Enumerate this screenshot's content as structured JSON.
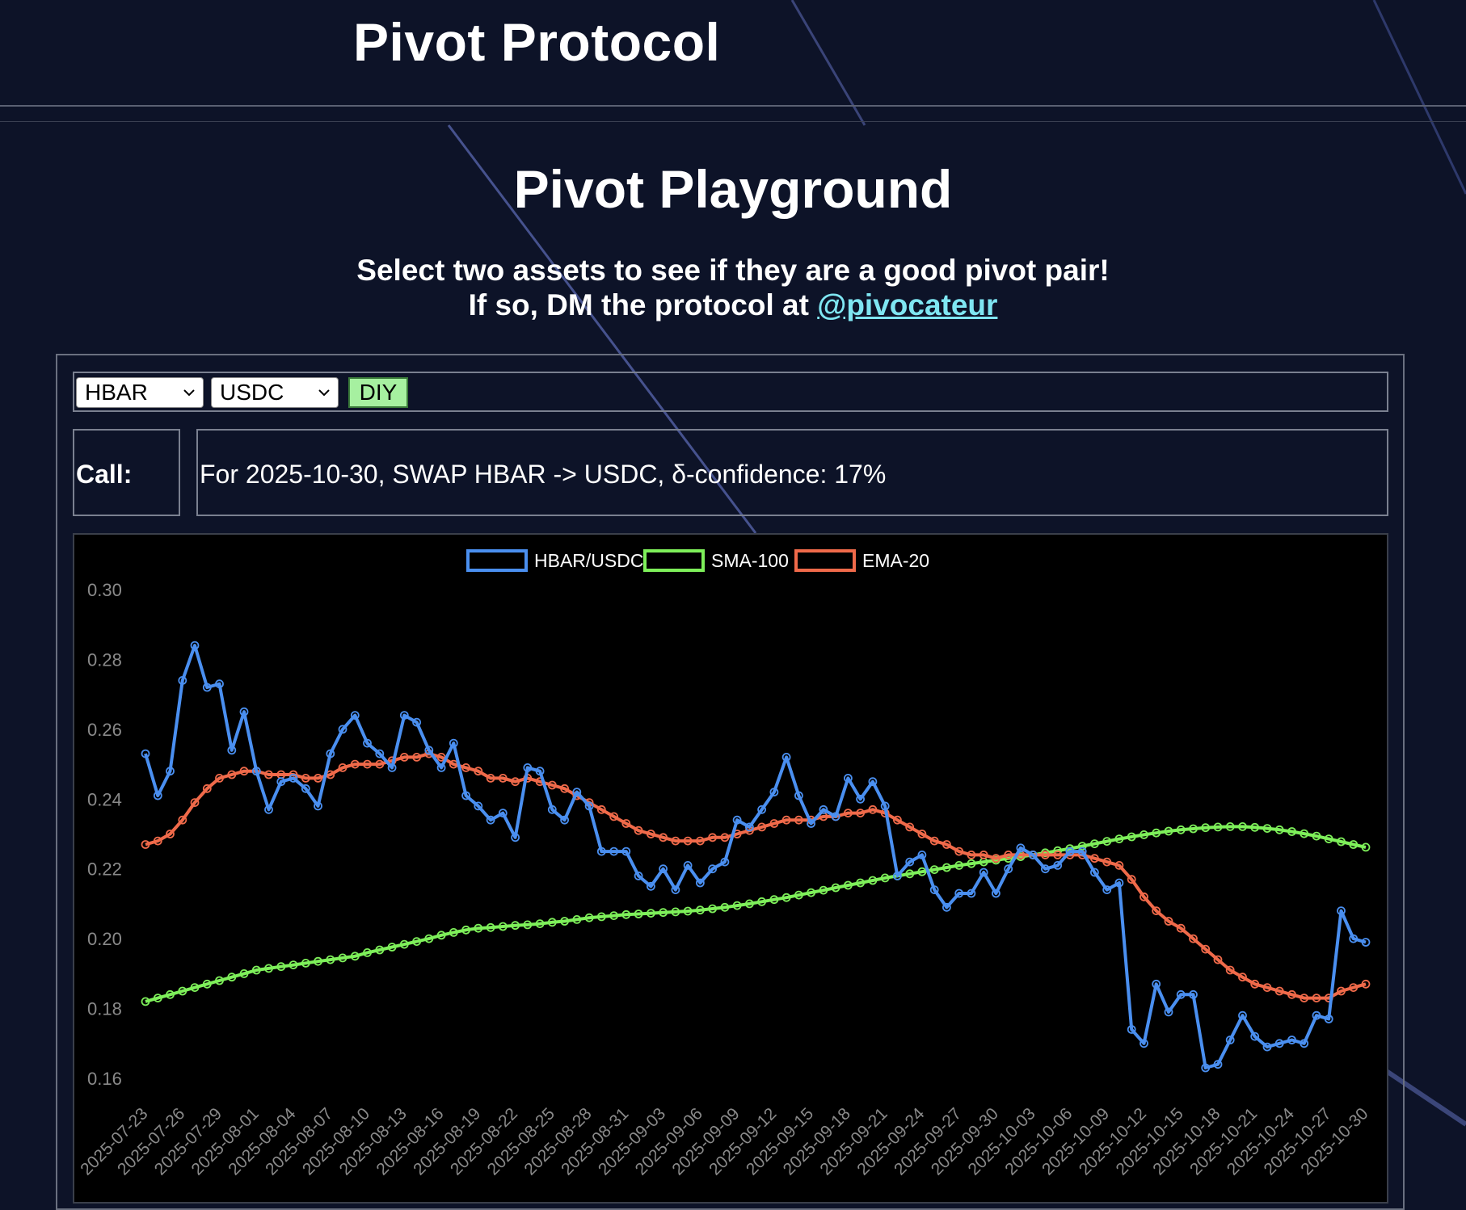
{
  "header": {
    "brand": "Pivot Protocol"
  },
  "main": {
    "title": "Pivot Playground",
    "subtitle_line1": "Select two assets to see if they are a good pivot pair!",
    "subtitle_line2_prefix": "If so, DM the protocol at ",
    "subtitle_link": "@pivocateur"
  },
  "controls": {
    "base_asset": "HBAR",
    "quote_asset": "USDC",
    "diy_label": "DIY"
  },
  "call": {
    "label": "Call:",
    "text": "For 2025-10-30, SWAP HBAR -> USDC, δ-confidence: 17%"
  },
  "colors": {
    "background": "#0d1328",
    "link": "#7fe6f2",
    "diy_button": "#a6f0a0"
  },
  "chart_data": {
    "type": "line",
    "title": "",
    "legend_position": "top",
    "grid": false,
    "ylim": [
      0.155,
      0.3
    ],
    "y_ticks": [
      "0.30",
      "0.28",
      "0.26",
      "0.24",
      "0.22",
      "0.20",
      "0.18",
      "0.16"
    ],
    "x_tick_labels": [
      "2025-07-23",
      "2025-07-26",
      "2025-07-29",
      "2025-08-01",
      "2025-08-04",
      "2025-08-07",
      "2025-08-10",
      "2025-08-13",
      "2025-08-16",
      "2025-08-19",
      "2025-08-22",
      "2025-08-25",
      "2025-08-28",
      "2025-08-31",
      "2025-09-03",
      "2025-09-06",
      "2025-09-09",
      "2025-09-12",
      "2025-09-15",
      "2025-09-18",
      "2025-09-21",
      "2025-09-24",
      "2025-09-27",
      "2025-09-30",
      "2025-10-03",
      "2025-10-06",
      "2025-10-09",
      "2025-10-12",
      "2025-10-15",
      "2025-10-18",
      "2025-10-21",
      "2025-10-24",
      "2025-10-27",
      "2025-10-30"
    ],
    "series": [
      {
        "name": "HBAR/USDC",
        "color": "#4a8ff0",
        "values": [
          0.253,
          0.241,
          0.248,
          0.274,
          0.284,
          0.272,
          0.273,
          0.254,
          0.265,
          0.248,
          0.237,
          0.245,
          0.246,
          0.243,
          0.238,
          0.253,
          0.26,
          0.264,
          0.256,
          0.253,
          0.249,
          0.264,
          0.262,
          0.254,
          0.249,
          0.256,
          0.241,
          0.238,
          0.234,
          0.236,
          0.229,
          0.249,
          0.248,
          0.237,
          0.234,
          0.242,
          0.238,
          0.225,
          0.225,
          0.225,
          0.218,
          0.215,
          0.22,
          0.214,
          0.221,
          0.216,
          0.22,
          0.222,
          0.234,
          0.232,
          0.237,
          0.242,
          0.252,
          0.241,
          0.233,
          0.237,
          0.235,
          0.246,
          0.24,
          0.245,
          0.238,
          0.218,
          0.222,
          0.224,
          0.214,
          0.209,
          0.213,
          0.213,
          0.219,
          0.213,
          0.22,
          0.226,
          0.224,
          0.22,
          0.221,
          0.225,
          0.225,
          0.219,
          0.214,
          0.216,
          0.174,
          0.17,
          0.187,
          0.179,
          0.184,
          0.184,
          0.163,
          0.164,
          0.171,
          0.178,
          0.172,
          0.169,
          0.17,
          0.171,
          0.17,
          0.178,
          0.177,
          0.208,
          0.2,
          0.199
        ]
      },
      {
        "name": "SMA-100",
        "color": "#7ef05a",
        "values": [
          0.182,
          0.183,
          0.184,
          0.185,
          0.186,
          0.187,
          0.188,
          0.189,
          0.19,
          0.191,
          0.1915,
          0.192,
          0.1925,
          0.193,
          0.1935,
          0.194,
          0.1945,
          0.195,
          0.196,
          0.1968,
          0.1976,
          0.1984,
          0.1992,
          0.2,
          0.201,
          0.2018,
          0.2025,
          0.203,
          0.2032,
          0.2035,
          0.2038,
          0.204,
          0.2043,
          0.2047,
          0.205,
          0.2055,
          0.206,
          0.2063,
          0.2066,
          0.2069,
          0.2071,
          0.2073,
          0.2075,
          0.2077,
          0.2079,
          0.2082,
          0.2086,
          0.209,
          0.2095,
          0.21,
          0.2106,
          0.2112,
          0.2118,
          0.2125,
          0.2132,
          0.2139,
          0.2146,
          0.2153,
          0.216,
          0.2167,
          0.2174,
          0.218,
          0.2186,
          0.2192,
          0.2198,
          0.2204,
          0.221,
          0.2215,
          0.222,
          0.2225,
          0.223,
          0.2235,
          0.224,
          0.2246,
          0.2252,
          0.2258,
          0.2265,
          0.2272,
          0.2279,
          0.2286,
          0.2292,
          0.2298,
          0.2303,
          0.2308,
          0.2312,
          0.2315,
          0.2318,
          0.232,
          0.2321,
          0.2321,
          0.2319,
          0.2316,
          0.2312,
          0.2307,
          0.2301,
          0.2294,
          0.2286,
          0.2278,
          0.227,
          0.2262
        ]
      },
      {
        "name": "EMA-20",
        "color": "#f06a4a",
        "values": [
          0.227,
          0.228,
          0.23,
          0.234,
          0.239,
          0.243,
          0.246,
          0.247,
          0.248,
          0.248,
          0.247,
          0.247,
          0.247,
          0.246,
          0.246,
          0.247,
          0.249,
          0.25,
          0.25,
          0.25,
          0.251,
          0.252,
          0.252,
          0.253,
          0.252,
          0.25,
          0.249,
          0.248,
          0.246,
          0.246,
          0.245,
          0.246,
          0.245,
          0.244,
          0.243,
          0.241,
          0.239,
          0.237,
          0.235,
          0.233,
          0.231,
          0.23,
          0.229,
          0.228,
          0.228,
          0.228,
          0.229,
          0.229,
          0.23,
          0.231,
          0.232,
          0.233,
          0.234,
          0.234,
          0.234,
          0.235,
          0.235,
          0.236,
          0.236,
          0.237,
          0.236,
          0.234,
          0.232,
          0.23,
          0.228,
          0.227,
          0.225,
          0.224,
          0.224,
          0.223,
          0.224,
          0.224,
          0.224,
          0.224,
          0.224,
          0.224,
          0.224,
          0.223,
          0.222,
          0.221,
          0.217,
          0.212,
          0.208,
          0.205,
          0.203,
          0.2,
          0.197,
          0.194,
          0.191,
          0.189,
          0.187,
          0.186,
          0.185,
          0.184,
          0.183,
          0.183,
          0.183,
          0.185,
          0.186,
          0.187
        ]
      }
    ]
  }
}
